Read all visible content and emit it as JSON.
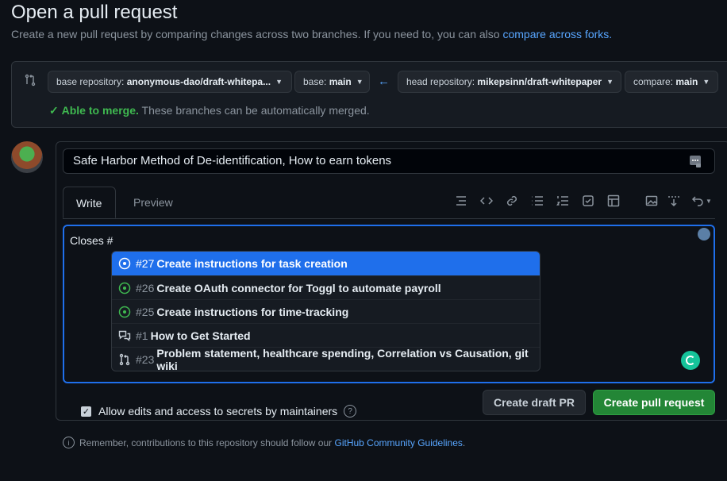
{
  "header": {
    "title": "Open a pull request",
    "subtitle": "Create a new pull request by comparing changes across two branches. If you need to, you can also",
    "subtitle_link": "compare across forks."
  },
  "compare": {
    "base_repo_label": "base repository:",
    "base_repo_value": "anonymous-dao/draft-whitepa...",
    "base_label": "base:",
    "base_value": "main",
    "head_repo_label": "head repository:",
    "head_repo_value": "mikepsinn/draft-whitepaper",
    "compare_label": "compare:",
    "compare_value": "main",
    "merge_status": "Able to merge.",
    "merge_text": "These branches can be automatically merged."
  },
  "form": {
    "title_value": "Safe Harbor Method of De-identification, How to earn tokens",
    "tabs": [
      "Write",
      "Preview"
    ],
    "body_text": "Closes #",
    "autocomplete": [
      {
        "num": "#27",
        "text": "Create instructions for task creation",
        "icon": "issue-open-icon"
      },
      {
        "num": "#26",
        "text": "Create OAuth connector for Toggl to automate payroll",
        "icon": "issue-open-icon"
      },
      {
        "num": "#25",
        "text": "Create instructions for time-tracking",
        "icon": "issue-open-icon"
      },
      {
        "num": "#1",
        "text": "How to Get Started",
        "icon": "discussion-icon"
      },
      {
        "num": "#23",
        "text": "Problem statement, healthcare spending, Correlation vs Causation, git wiki",
        "icon": "pull-request-icon"
      }
    ],
    "draft_button": "Create draft PR",
    "create_button": "Create pull request",
    "allow_edits": "Allow edits and access to secrets by maintainers"
  },
  "footer": {
    "text": "Remember, contributions to this repository should follow our",
    "link": "GitHub Community Guidelines",
    "end": "."
  },
  "colors": {
    "accent": "#1f6feb",
    "success": "#238636",
    "link": "#58a6ff"
  }
}
